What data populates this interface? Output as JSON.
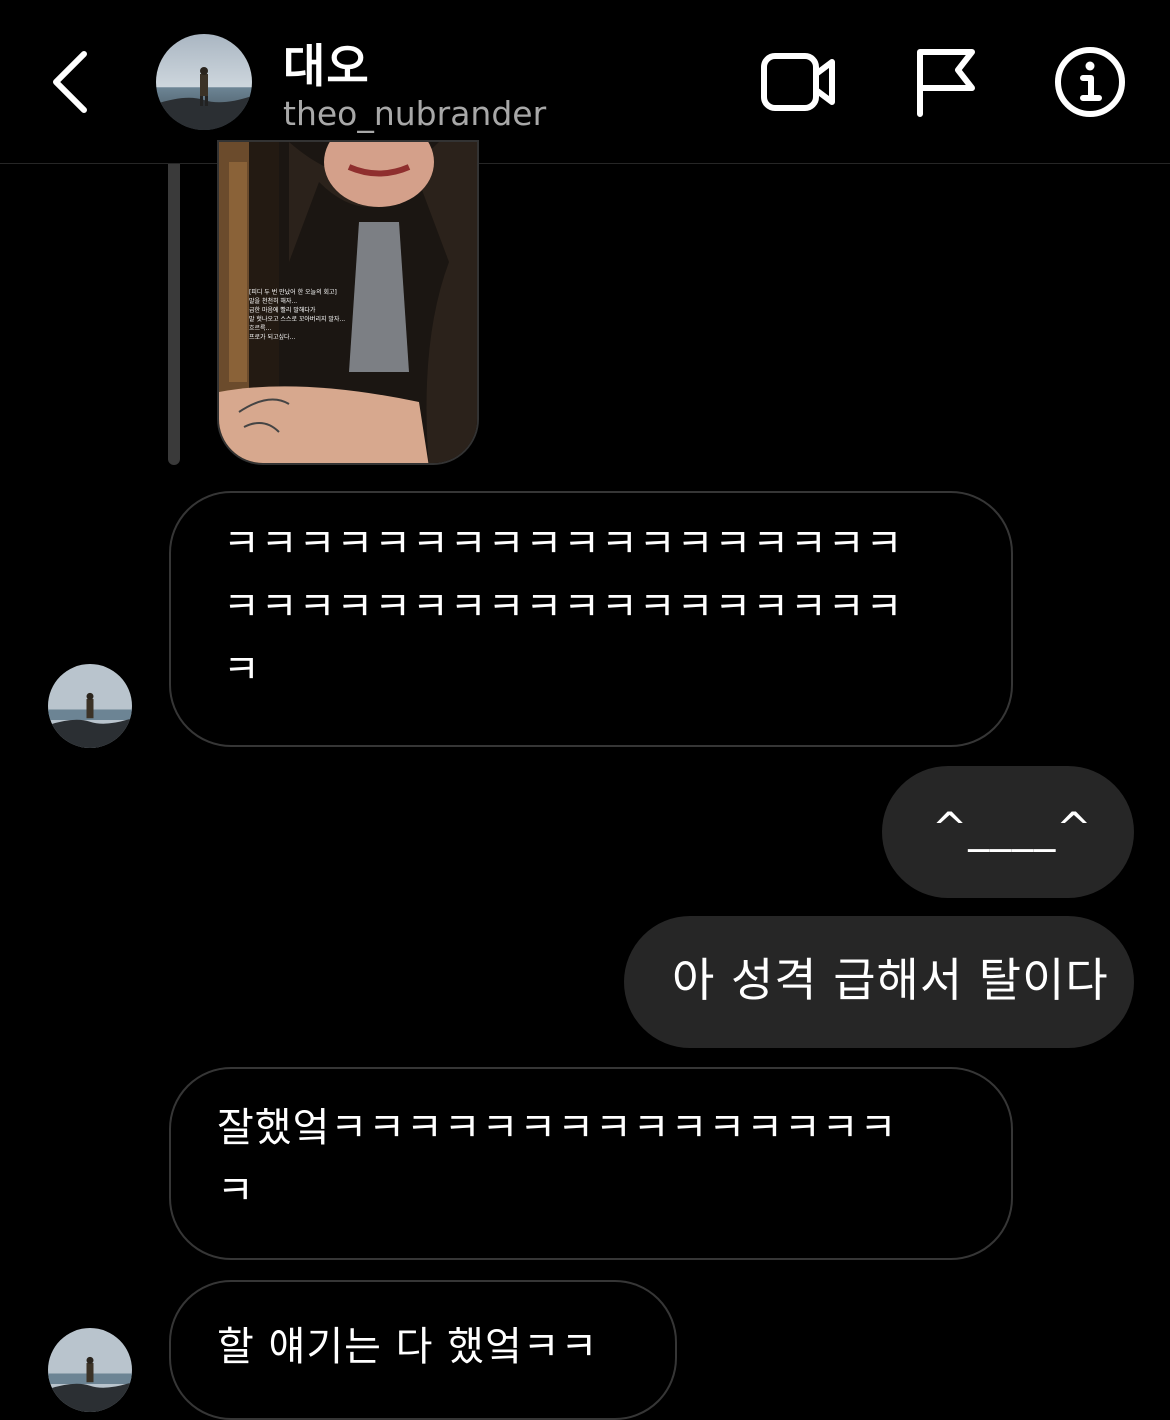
{
  "header": {
    "title": "대오",
    "username": "theo_nubrander",
    "back_icon": "chevron-left-icon",
    "video_icon": "video-camera-icon",
    "flag_icon": "flag-icon",
    "info_icon": "info-icon"
  },
  "shared_image": {
    "caption": "[피디 두 번 만났어 한 오늘의 회고]\n말을 천천히 해자...\n급한 마음에 빨리 말해다가\n말 헛나오고 스스로 꼬아버리지 말자...\n흐르륵...\n프로가 되고싶다..."
  },
  "messages": [
    {
      "sender": "them",
      "text": "ㅋㅋㅋㅋㅋㅋㅋㅋㅋㅋㅋㅋㅋㅋㅋㅋㅋㅋ\nㅋㅋㅋㅋㅋㅋㅋㅋㅋㅋㅋㅋㅋㅋㅋㅋㅋㅋ\nㅋ"
    },
    {
      "sender": "me",
      "text": "^____^"
    },
    {
      "sender": "me",
      "text": "아 성격 급해서 탈이다"
    },
    {
      "sender": "them",
      "text": "잘했엌ㅋㅋㅋㅋㅋㅋㅋㅋㅋㅋㅋㅋㅋㅋㅋ\nㅋ"
    },
    {
      "sender": "them",
      "text": "할 얘기는 다 했엌ㅋㅋ"
    }
  ],
  "colors": {
    "background": "#000000",
    "outgoing_bubble": "#262626",
    "incoming_border": "#363636",
    "subtitle": "#a8a8a8"
  }
}
